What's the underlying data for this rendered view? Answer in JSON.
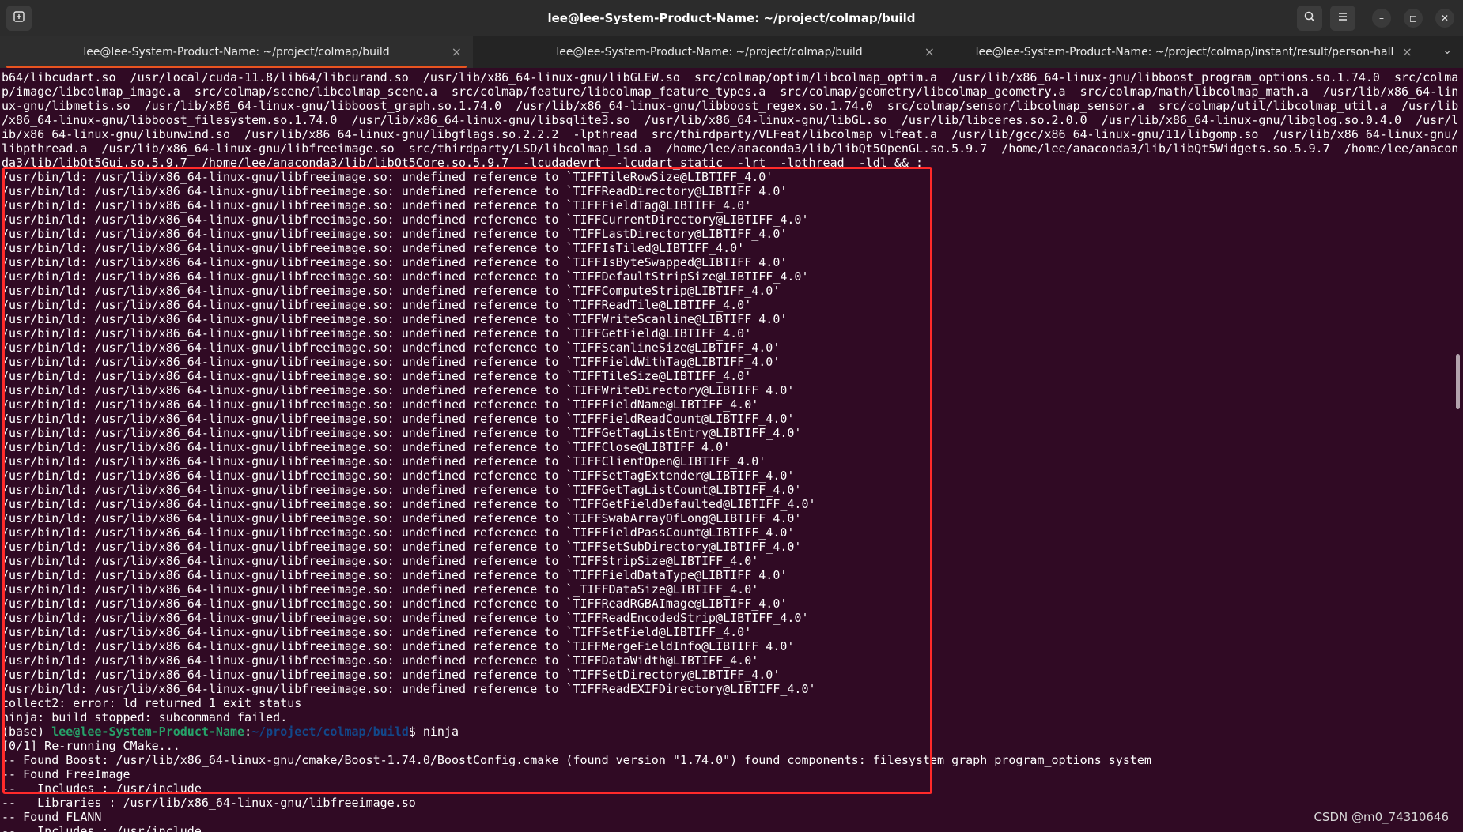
{
  "window": {
    "title": "lee@lee-System-Product-Name: ~/project/colmap/build",
    "new_tab_icon": "new-tab-icon",
    "search_icon": "search-icon",
    "menu_icon": "hamburger-menu-icon",
    "minimize_glyph": "–",
    "maximize_glyph": "◻",
    "close_glyph": "✕"
  },
  "tabs": [
    {
      "label": "lee@lee-System-Product-Name: ~/project/colmap/build",
      "active": true
    },
    {
      "label": "lee@lee-System-Product-Name: ~/project/colmap/build",
      "active": false
    },
    {
      "label": "lee@lee-System-Product-Name: ~/project/colmap/instant/result/person-hall",
      "active": false
    }
  ],
  "tab_close_glyph": "×",
  "tabs_menu_glyph": "⌄",
  "terminal": {
    "lines": [
      "b64/libcudart.so  /usr/local/cuda-11.8/lib64/libcurand.so  /usr/lib/x86_64-linux-gnu/libGLEW.so  src/colmap/optim/libcolmap_optim.a  /usr/lib/x86_64-linux-gnu/libboost_program_options.so.1.74.0  src/colma",
      "p/image/libcolmap_image.a  src/colmap/scene/libcolmap_scene.a  src/colmap/feature/libcolmap_feature_types.a  src/colmap/geometry/libcolmap_geometry.a  src/colmap/math/libcolmap_math.a  /usr/lib/x86_64-lin",
      "ux-gnu/libmetis.so  /usr/lib/x86_64-linux-gnu/libboost_graph.so.1.74.0  /usr/lib/x86_64-linux-gnu/libboost_regex.so.1.74.0  src/colmap/sensor/libcolmap_sensor.a  src/colmap/util/libcolmap_util.a  /usr/lib",
      "/x86_64-linux-gnu/libboost_filesystem.so.1.74.0  /usr/lib/x86_64-linux-gnu/libsqlite3.so  /usr/lib/x86_64-linux-gnu/libGL.so  /usr/lib/libceres.so.2.0.0  /usr/lib/x86_64-linux-gnu/libglog.so.0.4.0  /usr/l",
      "ib/x86_64-linux-gnu/libunwind.so  /usr/lib/x86_64-linux-gnu/libgflags.so.2.2.2  -lpthread  src/thirdparty/VLFeat/libcolmap_vlfeat.a  /usr/lib/gcc/x86_64-linux-gnu/11/libgomp.so  /usr/lib/x86_64-linux-gnu/",
      "libpthread.a  /usr/lib/x86_64-linux-gnu/libfreeimage.so  src/thirdparty/LSD/libcolmap_lsd.a  /home/lee/anaconda3/lib/libQt5OpenGL.so.5.9.7  /home/lee/anaconda3/lib/libQt5Widgets.so.5.9.7  /home/lee/anacon",
      "da3/lib/libQt5Gui.so.5.9.7  /home/lee/anaconda3/lib/libQt5Core.so.5.9.7  -lcudadevrt  -lcudart_static  -lrt  -lpthread  -ldl && :",
      "/usr/bin/ld: /usr/lib/x86_64-linux-gnu/libfreeimage.so: undefined reference to `TIFFTileRowSize@LIBTIFF_4.0'",
      "/usr/bin/ld: /usr/lib/x86_64-linux-gnu/libfreeimage.so: undefined reference to `TIFFReadDirectory@LIBTIFF_4.0'",
      "/usr/bin/ld: /usr/lib/x86_64-linux-gnu/libfreeimage.so: undefined reference to `TIFFFieldTag@LIBTIFF_4.0'",
      "/usr/bin/ld: /usr/lib/x86_64-linux-gnu/libfreeimage.so: undefined reference to `TIFFCurrentDirectory@LIBTIFF_4.0'",
      "/usr/bin/ld: /usr/lib/x86_64-linux-gnu/libfreeimage.so: undefined reference to `TIFFLastDirectory@LIBTIFF_4.0'",
      "/usr/bin/ld: /usr/lib/x86_64-linux-gnu/libfreeimage.so: undefined reference to `TIFFIsTiled@LIBTIFF_4.0'",
      "/usr/bin/ld: /usr/lib/x86_64-linux-gnu/libfreeimage.so: undefined reference to `TIFFIsByteSwapped@LIBTIFF_4.0'",
      "/usr/bin/ld: /usr/lib/x86_64-linux-gnu/libfreeimage.so: undefined reference to `TIFFDefaultStripSize@LIBTIFF_4.0'",
      "/usr/bin/ld: /usr/lib/x86_64-linux-gnu/libfreeimage.so: undefined reference to `TIFFComputeStrip@LIBTIFF_4.0'",
      "/usr/bin/ld: /usr/lib/x86_64-linux-gnu/libfreeimage.so: undefined reference to `TIFFReadTile@LIBTIFF_4.0'",
      "/usr/bin/ld: /usr/lib/x86_64-linux-gnu/libfreeimage.so: undefined reference to `TIFFWriteScanline@LIBTIFF_4.0'",
      "/usr/bin/ld: /usr/lib/x86_64-linux-gnu/libfreeimage.so: undefined reference to `TIFFGetField@LIBTIFF_4.0'",
      "/usr/bin/ld: /usr/lib/x86_64-linux-gnu/libfreeimage.so: undefined reference to `TIFFScanlineSize@LIBTIFF_4.0'",
      "/usr/bin/ld: /usr/lib/x86_64-linux-gnu/libfreeimage.so: undefined reference to `TIFFFieldWithTag@LIBTIFF_4.0'",
      "/usr/bin/ld: /usr/lib/x86_64-linux-gnu/libfreeimage.so: undefined reference to `TIFFTileSize@LIBTIFF_4.0'",
      "/usr/bin/ld: /usr/lib/x86_64-linux-gnu/libfreeimage.so: undefined reference to `TIFFWriteDirectory@LIBTIFF_4.0'",
      "/usr/bin/ld: /usr/lib/x86_64-linux-gnu/libfreeimage.so: undefined reference to `TIFFFieldName@LIBTIFF_4.0'",
      "/usr/bin/ld: /usr/lib/x86_64-linux-gnu/libfreeimage.so: undefined reference to `TIFFFieldReadCount@LIBTIFF_4.0'",
      "/usr/bin/ld: /usr/lib/x86_64-linux-gnu/libfreeimage.so: undefined reference to `TIFFGetTagListEntry@LIBTIFF_4.0'",
      "/usr/bin/ld: /usr/lib/x86_64-linux-gnu/libfreeimage.so: undefined reference to `TIFFClose@LIBTIFF_4.0'",
      "/usr/bin/ld: /usr/lib/x86_64-linux-gnu/libfreeimage.so: undefined reference to `TIFFClientOpen@LIBTIFF_4.0'",
      "/usr/bin/ld: /usr/lib/x86_64-linux-gnu/libfreeimage.so: undefined reference to `TIFFSetTagExtender@LIBTIFF_4.0'",
      "/usr/bin/ld: /usr/lib/x86_64-linux-gnu/libfreeimage.so: undefined reference to `TIFFGetTagListCount@LIBTIFF_4.0'",
      "/usr/bin/ld: /usr/lib/x86_64-linux-gnu/libfreeimage.so: undefined reference to `TIFFGetFieldDefaulted@LIBTIFF_4.0'",
      "/usr/bin/ld: /usr/lib/x86_64-linux-gnu/libfreeimage.so: undefined reference to `TIFFSwabArrayOfLong@LIBTIFF_4.0'",
      "/usr/bin/ld: /usr/lib/x86_64-linux-gnu/libfreeimage.so: undefined reference to `TIFFFieldPassCount@LIBTIFF_4.0'",
      "/usr/bin/ld: /usr/lib/x86_64-linux-gnu/libfreeimage.so: undefined reference to `TIFFSetSubDirectory@LIBTIFF_4.0'",
      "/usr/bin/ld: /usr/lib/x86_64-linux-gnu/libfreeimage.so: undefined reference to `TIFFStripSize@LIBTIFF_4.0'",
      "/usr/bin/ld: /usr/lib/x86_64-linux-gnu/libfreeimage.so: undefined reference to `TIFFFieldDataType@LIBTIFF_4.0'",
      "/usr/bin/ld: /usr/lib/x86_64-linux-gnu/libfreeimage.so: undefined reference to `_TIFFDataSize@LIBTIFF_4.0'",
      "/usr/bin/ld: /usr/lib/x86_64-linux-gnu/libfreeimage.so: undefined reference to `TIFFReadRGBAImage@LIBTIFF_4.0'",
      "/usr/bin/ld: /usr/lib/x86_64-linux-gnu/libfreeimage.so: undefined reference to `TIFFReadEncodedStrip@LIBTIFF_4.0'",
      "/usr/bin/ld: /usr/lib/x86_64-linux-gnu/libfreeimage.so: undefined reference to `TIFFSetField@LIBTIFF_4.0'",
      "/usr/bin/ld: /usr/lib/x86_64-linux-gnu/libfreeimage.so: undefined reference to `TIFFMergeFieldInfo@LIBTIFF_4.0'",
      "/usr/bin/ld: /usr/lib/x86_64-linux-gnu/libfreeimage.so: undefined reference to `TIFFDataWidth@LIBTIFF_4.0'",
      "/usr/bin/ld: /usr/lib/x86_64-linux-gnu/libfreeimage.so: undefined reference to `TIFFSetDirectory@LIBTIFF_4.0'",
      "/usr/bin/ld: /usr/lib/x86_64-linux-gnu/libfreeimage.so: undefined reference to `TIFFReadEXIFDirectory@LIBTIFF_4.0'",
      "collect2: error: ld returned 1 exit status",
      "ninja: build stopped: subcommand failed."
    ],
    "prompt": {
      "env": "(base) ",
      "user_host": "lee@lee-System-Product-Name",
      "sep": ":",
      "path": "~/project/colmap/build",
      "symbol": "$ ",
      "command": "ninja"
    },
    "after_lines": [
      "[0/1] Re-running CMake...",
      "-- Found Boost: /usr/lib/x86_64-linux-gnu/cmake/Boost-1.74.0/BoostConfig.cmake (found version \"1.74.0\") found components: filesystem graph program_options system",
      "-- Found FreeImage",
      "--   Includes : /usr/include",
      "--   Libraries : /usr/lib/x86_64-linux-gnu/libfreeimage.so",
      "-- Found FLANN",
      "--   Includes : /usr/include"
    ]
  },
  "watermark": "CSDN @m0_74310646",
  "colors": {
    "terminal_bg": "#300a24",
    "highlight_border": "#ff2a2a",
    "tab_accent": "#e95420",
    "prompt_user": "#26a269",
    "prompt_path": "#12488b"
  }
}
